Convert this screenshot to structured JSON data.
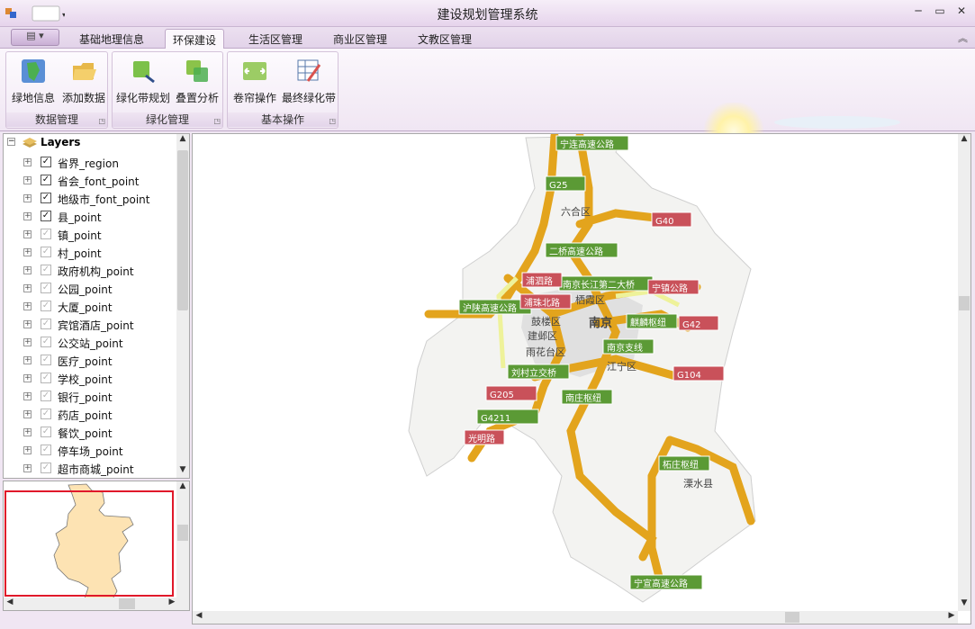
{
  "window": {
    "title": "建设规划管理系统"
  },
  "tabs": [
    {
      "label": "基础地理信息"
    },
    {
      "label": "环保建设"
    },
    {
      "label": "生活区管理"
    },
    {
      "label": "商业区管理"
    },
    {
      "label": "文教区管理"
    }
  ],
  "ribbon": {
    "groups": [
      {
        "title": "数据管理",
        "buttons": [
          {
            "label": "绿地信息"
          },
          {
            "label": "添加数据"
          }
        ]
      },
      {
        "title": "绿化管理",
        "buttons": [
          {
            "label": "绿化带规划"
          },
          {
            "label": "叠置分析"
          }
        ]
      },
      {
        "title": "基本操作",
        "buttons": [
          {
            "label": "卷帘操作"
          },
          {
            "label": "最终绿化带"
          }
        ]
      }
    ]
  },
  "toc": {
    "root": "Layers",
    "layers": [
      {
        "name": "省界_region",
        "checked": true
      },
      {
        "name": "省会_font_point",
        "checked": true
      },
      {
        "name": "地级市_font_point",
        "checked": true
      },
      {
        "name": "县_point",
        "checked": true
      },
      {
        "name": "镇_point",
        "checked": false
      },
      {
        "name": "村_point",
        "checked": false
      },
      {
        "name": "政府机构_point",
        "checked": false
      },
      {
        "name": "公园_point",
        "checked": false
      },
      {
        "name": "大厦_point",
        "checked": false
      },
      {
        "name": "宾馆酒店_point",
        "checked": false
      },
      {
        "name": "公交站_point",
        "checked": false
      },
      {
        "name": "医疗_point",
        "checked": false
      },
      {
        "name": "学校_point",
        "checked": false
      },
      {
        "name": "银行_point",
        "checked": false
      },
      {
        "name": "药店_point",
        "checked": false
      },
      {
        "name": "餐饮_point",
        "checked": false
      },
      {
        "name": "停车场_point",
        "checked": false
      },
      {
        "name": "超市商城_point",
        "checked": false
      }
    ]
  },
  "map": {
    "districts": [
      "六合区",
      "栖霞区",
      "南京",
      "鼓楼区",
      "建邺区",
      "雨花台区",
      "江宁区",
      "溧水县"
    ],
    "green_labels": [
      "宁连高速公路",
      "G25",
      "二桥高速公路",
      "南京长江第二大桥",
      "沪陕高速公路",
      "麒麟枢纽",
      "南京支线",
      "刘村立交桥",
      "南庄枢纽",
      "G4211",
      "柘庄枢纽",
      "宁宣高速公路"
    ],
    "red_labels": [
      "G40",
      "浦泗路",
      "浦珠北路",
      "宁镇公路",
      "G42",
      "G104",
      "G205",
      "光明路"
    ]
  }
}
